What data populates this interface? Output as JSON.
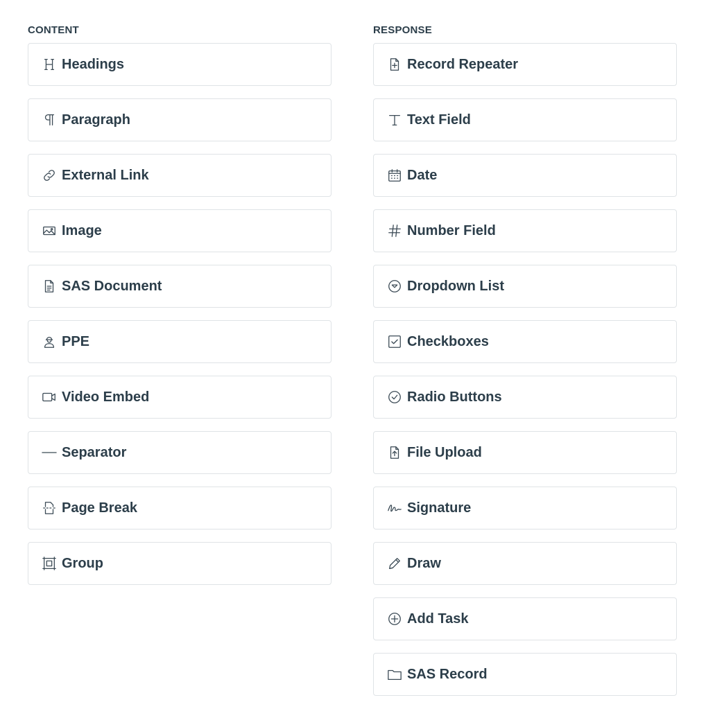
{
  "content": {
    "title": "CONTENT",
    "items": [
      {
        "label": "Headings",
        "icon": "heading-icon"
      },
      {
        "label": "Paragraph",
        "icon": "paragraph-icon"
      },
      {
        "label": "External Link",
        "icon": "link-icon"
      },
      {
        "label": "Image",
        "icon": "image-icon"
      },
      {
        "label": "SAS Document",
        "icon": "document-icon"
      },
      {
        "label": "PPE",
        "icon": "ppe-icon"
      },
      {
        "label": "Video Embed",
        "icon": "video-icon"
      },
      {
        "label": "Separator",
        "icon": "separator-icon"
      },
      {
        "label": "Page Break",
        "icon": "page-break-icon"
      },
      {
        "label": "Group",
        "icon": "group-icon"
      }
    ]
  },
  "response": {
    "title": "RESPONSE",
    "items": [
      {
        "label": "Record Repeater",
        "icon": "record-repeater-icon"
      },
      {
        "label": "Text Field",
        "icon": "text-icon"
      },
      {
        "label": "Date",
        "icon": "calendar-icon"
      },
      {
        "label": "Number Field",
        "icon": "hash-icon"
      },
      {
        "label": "Dropdown List",
        "icon": "dropdown-icon"
      },
      {
        "label": "Checkboxes",
        "icon": "checkbox-icon"
      },
      {
        "label": "Radio Buttons",
        "icon": "radio-icon"
      },
      {
        "label": "File Upload",
        "icon": "file-upload-icon"
      },
      {
        "label": "Signature",
        "icon": "signature-icon"
      },
      {
        "label": "Draw",
        "icon": "pencil-icon"
      },
      {
        "label": "Add Task",
        "icon": "plus-circle-icon"
      },
      {
        "label": "SAS Record",
        "icon": "folder-icon"
      }
    ]
  },
  "colors": {
    "text": "#2c3e4a",
    "border": "#dfe3e6",
    "background": "#ffffff"
  }
}
